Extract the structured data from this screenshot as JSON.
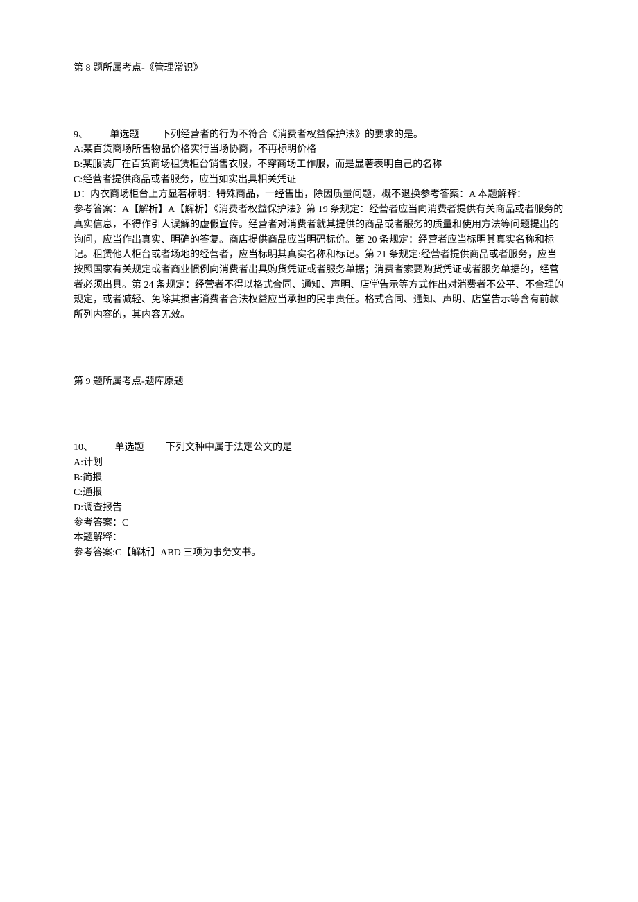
{
  "q8": {
    "topic_line": "第 8 题所属考点-《管理常识》"
  },
  "q9": {
    "number": "9、",
    "type_label": "单选题",
    "stem": "下列经营者的行为不符合《消费者权益保护法》的要求的是。",
    "options": {
      "a": "A:某百货商场所售物品价格实行当场协商，不再标明价格",
      "b": "B:某服装厂在百货商场租赁柜台销售衣服，不穿商场工作服，而是显著表明自己的名称",
      "c": "C:经营者提供商品或者服务，应当如实出具相关凭证",
      "d": "D：内衣商场柜台上方显著标明：特殊商品，一经售出，除因质量问题，概不退换参考答案：A 本题解释："
    },
    "explanation": "参考答案：A【解析】A【解析】《消费者权益保护法》第 19 条规定：经营者应当向消费者提供有关商品或者服务的真实信息，不得作引人误解的虚假宣传。经营者对消费者就其提供的商品或者服务的质量和使用方法等问题提出的询问，应当作出真实、明确的答复。商店提供商品应当明码标价。第 20 条规定：经营者应当标明其真实名称和标记。租赁他人柜台或者场地的经营者，应当标明其真实名称和标记。第 21 条规定:经营者提供商品或者服务，应当按照国家有关规定或者商业惯例向消费者出具购货凭证或者服务单据；消费者索要购货凭证或者服务单据的，经营者必须出具。第 24 条规定：经营者不得以格式合同、通知、声明、店堂告示等方式作出对消费者不公平、不合理的规定，或者减轻、免除其损害消费者合法权益应当承担的民事责任。格式合同、通知、声明、店堂告示等含有前款所列内容的，其内容无效。",
    "topic_line": "第 9 题所属考点-题库原题"
  },
  "q10": {
    "number": "10、",
    "type_label": "单选题",
    "stem": "下列文种中属于法定公文的是",
    "options": {
      "a": "A:计划",
      "b": "B:简报",
      "c": "C:通报",
      "d": "D:调查报告"
    },
    "answer_line": "参考答案：C",
    "explain_label": "本题解释：",
    "explanation": "参考答案:C【解析】ABD 三项为事务文书。"
  }
}
